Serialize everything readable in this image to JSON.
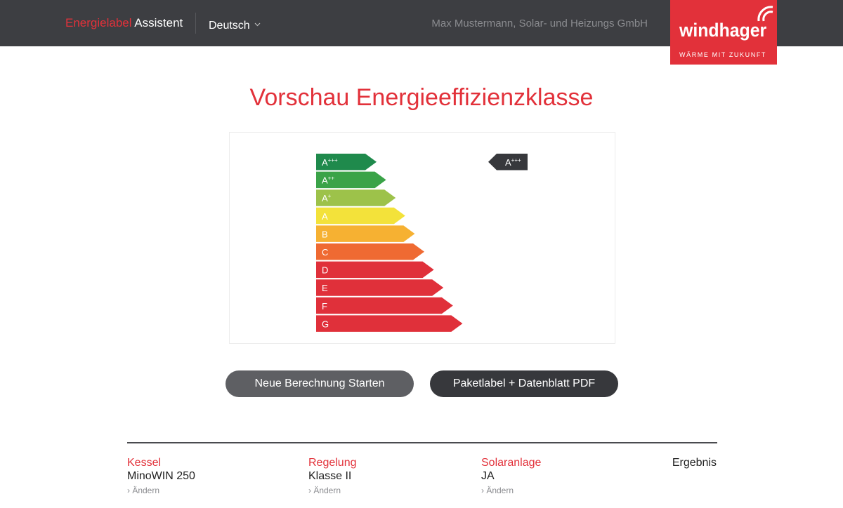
{
  "header": {
    "brand_accent": "Energielabel",
    "brand_rest": " Assistent",
    "language": "Deutsch",
    "company": "Max Mustermann, Solar- und Heizungs GmbH",
    "logo": {
      "word": "windhager",
      "tagline": "WÄRME MIT ZUKUNFT"
    }
  },
  "colors": {
    "accent": "#e2313a",
    "header_bg": "#3d3e42"
  },
  "main": {
    "title": "Vorschau Energieeffizienzklasse",
    "energy_label": {
      "classes": [
        {
          "base": "A",
          "sup": "+++",
          "color": "#1f8a4c"
        },
        {
          "base": "A",
          "sup": "++",
          "color": "#3aa348"
        },
        {
          "base": "A",
          "sup": "+",
          "color": "#9dc24a"
        },
        {
          "base": "A",
          "sup": "",
          "color": "#f3e23a"
        },
        {
          "base": "B",
          "sup": "",
          "color": "#f6b132"
        },
        {
          "base": "C",
          "sup": "",
          "color": "#ef6a32"
        },
        {
          "base": "D",
          "sup": "",
          "color": "#e0303a"
        },
        {
          "base": "E",
          "sup": "",
          "color": "#e0303a"
        },
        {
          "base": "F",
          "sup": "",
          "color": "#e0303a"
        },
        {
          "base": "G",
          "sup": "",
          "color": "#e0303a"
        }
      ],
      "result": {
        "base": "A",
        "sup": "+++",
        "class_index": 0
      }
    },
    "buttons": {
      "new_calc": "Neue Berechnung Starten",
      "pdf": "Paketlabel + Datenblatt PDF"
    }
  },
  "summary": {
    "items": [
      {
        "label": "Kessel",
        "value": "MinoWIN 250",
        "change": "› Ändern"
      },
      {
        "label": "Regelung",
        "value": "Klasse II",
        "change": "› Ändern"
      },
      {
        "label": "Solaranlage",
        "value": "JA",
        "change": "› Ändern"
      }
    ],
    "result_label": "Ergebnis"
  }
}
